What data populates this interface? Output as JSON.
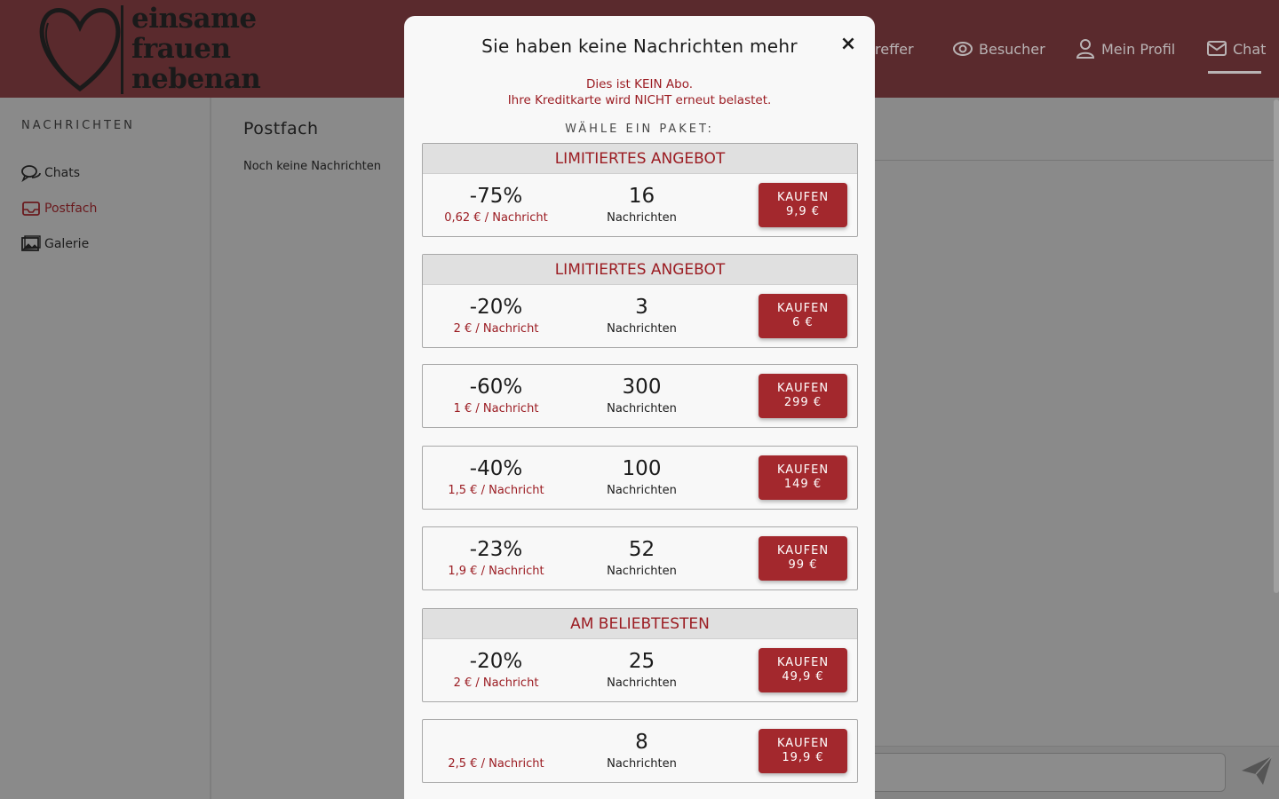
{
  "logo": {
    "line1": "einsame",
    "line2": "frauen",
    "line3": "nebenan"
  },
  "nav": {
    "treffer": "reffer",
    "besucher": "Besucher",
    "profil": "Mein Profil",
    "chat": "Chat"
  },
  "sidebar": {
    "title": "NACHRICHTEN",
    "items": [
      {
        "label": "Chats",
        "icon": "chats-icon"
      },
      {
        "label": "Postfach",
        "icon": "inbox-icon"
      },
      {
        "label": "Galerie",
        "icon": "gallery-icon"
      }
    ]
  },
  "main": {
    "title": "Postfach",
    "empty_text": "Noch keine Nachrichten"
  },
  "modal": {
    "title": "Sie haben keine Nachrichten mehr",
    "close": "×",
    "note_line1": "Dies ist KEIN Abo.",
    "note_line2": "Ihre Kreditkarte wird NICHT erneut belastet.",
    "choose": "WÄHLE EIN PAKET:",
    "packages": [
      {
        "header": "LIMITIERTES ANGEBOT",
        "discount": "-75%",
        "unit_price": "0,62 € / Nachricht",
        "count": "16",
        "count_label": "Nachrichten",
        "buy_label": "KAUFEN",
        "price": "9,9 €"
      },
      {
        "header": "LIMITIERTES ANGEBOT",
        "discount": "-20%",
        "unit_price": "2 € / Nachricht",
        "count": "3",
        "count_label": "Nachrichten",
        "buy_label": "KAUFEN",
        "price": "6 €"
      },
      {
        "header": "",
        "discount": "-60%",
        "unit_price": "1 € / Nachricht",
        "count": "300",
        "count_label": "Nachrichten",
        "buy_label": "KAUFEN",
        "price": "299 €"
      },
      {
        "header": "",
        "discount": "-40%",
        "unit_price": "1,5 € / Nachricht",
        "count": "100",
        "count_label": "Nachrichten",
        "buy_label": "KAUFEN",
        "price": "149 €"
      },
      {
        "header": "",
        "discount": "-23%",
        "unit_price": "1,9 € / Nachricht",
        "count": "52",
        "count_label": "Nachrichten",
        "buy_label": "KAUFEN",
        "price": "99 €"
      },
      {
        "header": "AM BELIEBTESTEN",
        "discount": "-20%",
        "unit_price": "2 € / Nachricht",
        "count": "25",
        "count_label": "Nachrichten",
        "buy_label": "KAUFEN",
        "price": "49,9 €"
      },
      {
        "header": "",
        "discount": "",
        "unit_price": "2,5 € / Nachricht",
        "count": "8",
        "count_label": "Nachrichten",
        "buy_label": "KAUFEN",
        "price": "19,9 €"
      }
    ]
  },
  "colors": {
    "header_bg": "#5a2a2d",
    "accent": "#a3282d",
    "accent_text": "#9b1c22",
    "overlay": "#8a8a8a"
  }
}
